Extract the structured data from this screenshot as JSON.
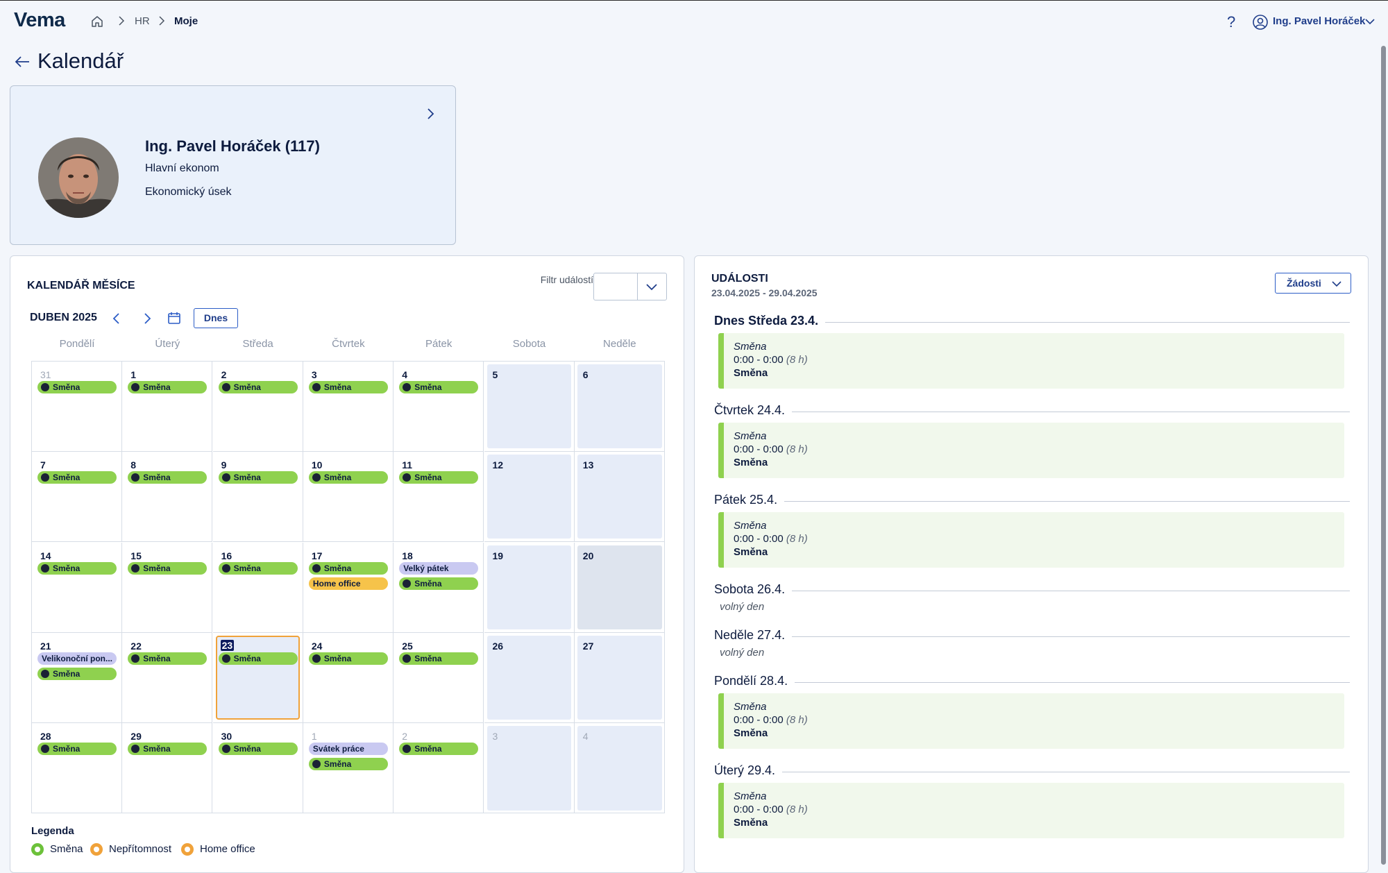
{
  "header": {
    "logo": "Vema",
    "breadcrumb": [
      "HR",
      "Moje"
    ],
    "help": "?",
    "user_name": "Ing. Pavel Horáček"
  },
  "page": {
    "title": "Kalendář"
  },
  "profile": {
    "name": "Ing. Pavel Horáček (117)",
    "job": "Hlavní ekonom",
    "department": "Ekonomický úsek"
  },
  "calendar": {
    "title": "KALENDÁŘ MĚSÍCE",
    "filter_label": "Filtr událostí",
    "month": "DUBEN 2025",
    "today_button": "Dnes",
    "weekdays": [
      "Pondělí",
      "Úterý",
      "Středa",
      "Čtvrtek",
      "Pátek",
      "Sobota",
      "Neděle"
    ],
    "weeks": [
      [
        {
          "d": "31",
          "muted": true,
          "ev": [
            {
              "t": "Směna",
              "c": "green"
            }
          ]
        },
        {
          "d": "1",
          "ev": [
            {
              "t": "Směna",
              "c": "green"
            }
          ]
        },
        {
          "d": "2",
          "ev": [
            {
              "t": "Směna",
              "c": "green"
            }
          ]
        },
        {
          "d": "3",
          "ev": [
            {
              "t": "Směna",
              "c": "green"
            }
          ]
        },
        {
          "d": "4",
          "ev": [
            {
              "t": "Směna",
              "c": "green"
            }
          ]
        },
        {
          "d": "5",
          "ev": []
        },
        {
          "d": "6",
          "ev": []
        }
      ],
      [
        {
          "d": "7",
          "ev": [
            {
              "t": "Směna",
              "c": "green"
            }
          ]
        },
        {
          "d": "8",
          "ev": [
            {
              "t": "Směna",
              "c": "green"
            }
          ]
        },
        {
          "d": "9",
          "ev": [
            {
              "t": "Směna",
              "c": "green"
            }
          ]
        },
        {
          "d": "10",
          "ev": [
            {
              "t": "Směna",
              "c": "green"
            }
          ]
        },
        {
          "d": "11",
          "ev": [
            {
              "t": "Směna",
              "c": "green"
            }
          ]
        },
        {
          "d": "12",
          "ev": []
        },
        {
          "d": "13",
          "ev": []
        }
      ],
      [
        {
          "d": "14",
          "ev": [
            {
              "t": "Směna",
              "c": "green"
            }
          ]
        },
        {
          "d": "15",
          "ev": [
            {
              "t": "Směna",
              "c": "green"
            }
          ]
        },
        {
          "d": "16",
          "ev": [
            {
              "t": "Směna",
              "c": "green"
            }
          ]
        },
        {
          "d": "17",
          "ev": [
            {
              "t": "Směna",
              "c": "green"
            },
            {
              "t": "Home office",
              "c": "orange"
            }
          ]
        },
        {
          "d": "18",
          "ev": [
            {
              "t": "Velký pátek",
              "c": "violet"
            },
            {
              "t": "Směna",
              "c": "green"
            }
          ]
        },
        {
          "d": "19",
          "ev": []
        },
        {
          "d": "20",
          "dark": true,
          "ev": []
        }
      ],
      [
        {
          "d": "21",
          "ev": [
            {
              "t": "Velikonoční pon...",
              "c": "violet"
            },
            {
              "t": "Směna",
              "c": "green"
            }
          ]
        },
        {
          "d": "22",
          "ev": [
            {
              "t": "Směna",
              "c": "green"
            }
          ]
        },
        {
          "d": "23",
          "today": true,
          "ev": [
            {
              "t": "Směna",
              "c": "green"
            }
          ]
        },
        {
          "d": "24",
          "ev": [
            {
              "t": "Směna",
              "c": "green"
            }
          ]
        },
        {
          "d": "25",
          "ev": [
            {
              "t": "Směna",
              "c": "green"
            }
          ]
        },
        {
          "d": "26",
          "ev": []
        },
        {
          "d": "27",
          "ev": []
        }
      ],
      [
        {
          "d": "28",
          "ev": [
            {
              "t": "Směna",
              "c": "green"
            }
          ]
        },
        {
          "d": "29",
          "ev": [
            {
              "t": "Směna",
              "c": "green"
            }
          ]
        },
        {
          "d": "30",
          "ev": [
            {
              "t": "Směna",
              "c": "green"
            }
          ]
        },
        {
          "d": "1",
          "muted": true,
          "ev": [
            {
              "t": "Svátek práce",
              "c": "violet"
            },
            {
              "t": "Směna",
              "c": "green"
            }
          ]
        },
        {
          "d": "2",
          "muted": true,
          "ev": [
            {
              "t": "Směna",
              "c": "green"
            }
          ]
        },
        {
          "d": "3",
          "muted": true,
          "ev": []
        },
        {
          "d": "4",
          "muted": true,
          "ev": []
        }
      ]
    ],
    "legend_title": "Legenda",
    "legend": [
      {
        "label": "Směna",
        "color": "#6cc13a"
      },
      {
        "label": "Nepřítomnost",
        "color": "#f0a23a"
      },
      {
        "label": "Home office",
        "color": "#f0a23a"
      }
    ]
  },
  "events": {
    "title": "UDÁLOSTI",
    "range": "23.04.2025 - 29.04.2025",
    "requests_button": "Žádosti",
    "days": [
      {
        "label": "Dnes Středa 23.4.",
        "bold": true,
        "items": [
          {
            "type": "Směna",
            "time": "0:00 - 0:00",
            "hours": "(8 h)",
            "name": "Směna"
          }
        ]
      },
      {
        "label": "Čtvrtek 24.4.",
        "items": [
          {
            "type": "Směna",
            "time": "0:00 - 0:00",
            "hours": "(8 h)",
            "name": "Směna"
          }
        ]
      },
      {
        "label": "Pátek 25.4.",
        "items": [
          {
            "type": "Směna",
            "time": "0:00 - 0:00",
            "hours": "(8 h)",
            "name": "Směna"
          }
        ]
      },
      {
        "label": "Sobota 26.4.",
        "free": "volný den",
        "items": []
      },
      {
        "label": "Neděle 27.4.",
        "free": "volný den",
        "items": []
      },
      {
        "label": "Pondělí 28.4.",
        "items": [
          {
            "type": "Směna",
            "time": "0:00 - 0:00",
            "hours": "(8 h)",
            "name": "Směna"
          }
        ]
      },
      {
        "label": "Úterý 29.4.",
        "items": [
          {
            "type": "Směna",
            "time": "0:00 - 0:00",
            "hours": "(8 h)",
            "name": "Směna"
          }
        ]
      }
    ]
  }
}
